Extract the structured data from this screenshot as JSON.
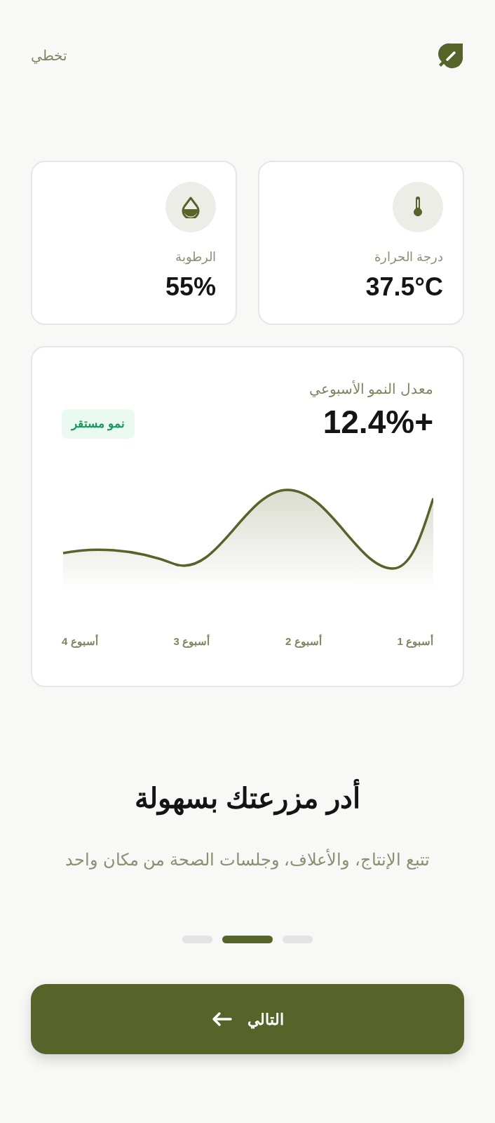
{
  "header": {
    "skip": "تخطي"
  },
  "stats": [
    {
      "kind": "temperature",
      "label": "درجة الحرارة",
      "value": "37.5°C"
    },
    {
      "kind": "humidity",
      "label": "الرطوبة",
      "value": "55%"
    }
  ],
  "growth": {
    "title": "معدل النمو الأسبوعي",
    "value": "12.4%+",
    "badge": "نمو مستقر",
    "weeks": [
      "أسبوع 1",
      "أسبوع 2",
      "أسبوع 3",
      "أسبوع 4"
    ]
  },
  "headline": "أدر مزرعتك بسهولة",
  "subtitle": "تتبع الإنتاج، والأعلاف، وجلسات الصحة من مكان واحد",
  "pager": [
    {
      "selected": false
    },
    {
      "selected": true
    },
    {
      "selected": false
    }
  ],
  "next_button": {
    "label": "التالي"
  }
}
